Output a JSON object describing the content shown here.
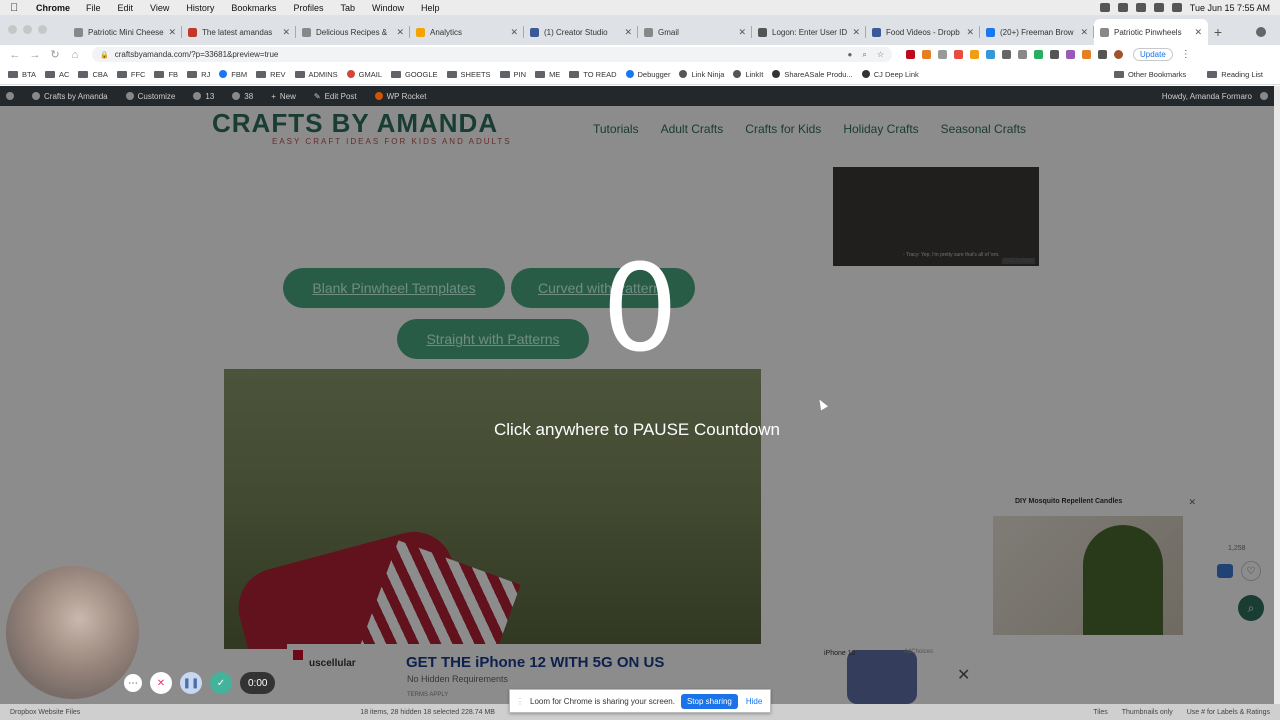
{
  "menubar": {
    "app_name": "Chrome",
    "menus": [
      "File",
      "Edit",
      "View",
      "History",
      "Bookmarks",
      "Profiles",
      "Tab",
      "Window",
      "Help"
    ],
    "datetime": "Tue Jun 15  7:55 AM"
  },
  "tabs": [
    {
      "title": "Patriotic Mini Cheese",
      "color": "#888"
    },
    {
      "title": "The latest amandas",
      "color": "#c0392b"
    },
    {
      "title": "Delicious Recipes &",
      "color": "#888"
    },
    {
      "title": "Analytics",
      "color": "#f4a300"
    },
    {
      "title": "(1) Creator Studio",
      "color": "#3b5998"
    },
    {
      "title": "Gmail",
      "color": "#888"
    },
    {
      "title": "Logon: Enter User ID",
      "color": "#555"
    },
    {
      "title": "Food Videos - Dropb",
      "color": "#3b5998"
    },
    {
      "title": "(20+) Freeman Brow",
      "color": "#1877f2"
    },
    {
      "title": "Patriotic Pinwheels",
      "color": "#888",
      "active": true
    }
  ],
  "toolbar": {
    "url": "craftsbyamanda.com/?p=33681&preview=true",
    "update_label": "Update"
  },
  "bookmarks": {
    "items": [
      {
        "label": "BTA",
        "type": "folder"
      },
      {
        "label": "AC",
        "type": "folder"
      },
      {
        "label": "CBA",
        "type": "folder"
      },
      {
        "label": "FFC",
        "type": "folder"
      },
      {
        "label": "FB",
        "type": "folder"
      },
      {
        "label": "RJ",
        "type": "folder"
      },
      {
        "label": "FBM",
        "type": "site",
        "color": "#1877f2"
      },
      {
        "label": "REV",
        "type": "folder"
      },
      {
        "label": "ADMINS",
        "type": "folder"
      },
      {
        "label": "GMAIL",
        "type": "site",
        "color": "#d44638"
      },
      {
        "label": "GOOGLE",
        "type": "folder"
      },
      {
        "label": "SHEETS",
        "type": "folder"
      },
      {
        "label": "PIN",
        "type": "folder"
      },
      {
        "label": "ME",
        "type": "folder"
      },
      {
        "label": "TO READ",
        "type": "folder"
      },
      {
        "label": "Debugger",
        "type": "site",
        "color": "#1877f2"
      },
      {
        "label": "Link Ninja",
        "type": "site",
        "color": "#555"
      },
      {
        "label": "LinkIt",
        "type": "site",
        "color": "#555"
      },
      {
        "label": "ShareASale Produ...",
        "type": "site",
        "color": "#333"
      },
      {
        "label": "CJ Deep Link",
        "type": "site",
        "color": "#333"
      }
    ],
    "other": "Other Bookmarks",
    "reading": "Reading List"
  },
  "wp_admin": {
    "site": "Crafts by Amanda",
    "customize": "Customize",
    "updates": "13",
    "comments": "38",
    "new": "New",
    "edit": "Edit Post",
    "rocket": "WP Rocket",
    "howdy": "Howdy, Amanda Formaro"
  },
  "site": {
    "logo": "CRAFTS BY AMANDA",
    "tagline": "EASY CRAFT IDEAS FOR KIDS AND ADULTS",
    "nav": [
      "Tutorials",
      "Adult Crafts",
      "Crafts for Kids",
      "Holiday Crafts",
      "Seasonal Crafts"
    ],
    "pills": [
      "Blank Pinwheel Templates",
      "Curved with Patterns",
      "Straight with Patterns"
    ],
    "video_caption": "- Tracy: Yep, I'm pretty sure that's all of 'em.",
    "adchoices": "AdChoices",
    "side_ad_title": "DIY Mosquito Repellent Candles",
    "like_count": "1,258",
    "bottom_ad": {
      "brand": "uscellular",
      "headline": "GET THE iPhone 12 WITH 5G ON US",
      "sub": "No Hidden Requirements",
      "terms": "TERMS APPLY",
      "phone_label": "iPhone 12"
    }
  },
  "overlay": {
    "countdown": "0",
    "message": "Click anywhere to PAUSE Countdown"
  },
  "loom": {
    "timer": "0:00",
    "share_text": "Loom for Chrome is sharing your screen.",
    "stop_label": "Stop sharing",
    "hide_label": "Hide"
  },
  "finder": {
    "left": "Dropbox Website Files",
    "middle": "18 items, 28 hidden    18 selected    228.74 MB",
    "tiles": "Tiles",
    "thumbs": "Thumbnails only",
    "use": "Use # for Labels & Ratings"
  }
}
